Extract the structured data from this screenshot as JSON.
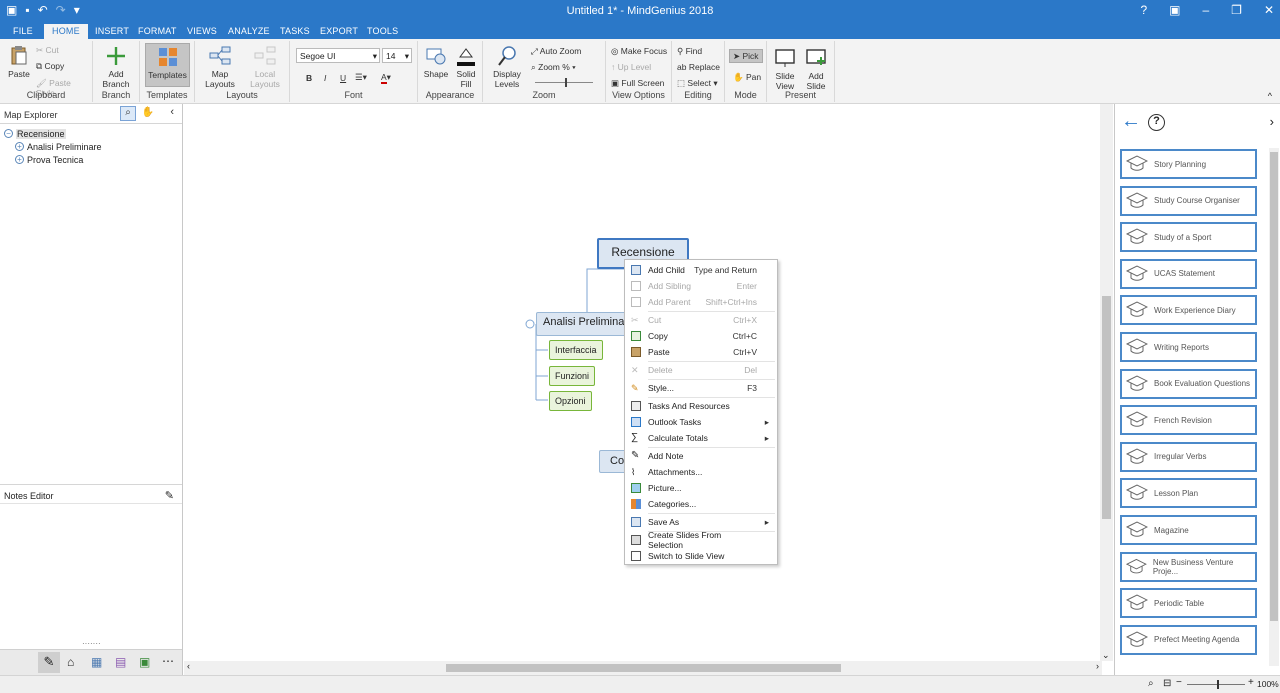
{
  "window": {
    "title": "Untitled 1* - MindGenius 2018"
  },
  "tabs": [
    "FILE",
    "HOME",
    "INSERT",
    "FORMAT",
    "VIEWS",
    "ANALYZE",
    "TASKS",
    "EXPORT",
    "TOOLS"
  ],
  "ribbon": {
    "clipboard": {
      "paste": "Paste",
      "cut": "Cut",
      "copy": "Copy",
      "paste_style": "Paste Style",
      "group": "Clipboard"
    },
    "branch": {
      "add_branch": "Add Branch",
      "group": "Branch"
    },
    "templates": {
      "templates": "Templates",
      "group": "Templates"
    },
    "layouts": {
      "map_layouts": "Map Layouts",
      "local_layouts": "Local Layouts",
      "group": "Layouts"
    },
    "font": {
      "family": "Segoe UI",
      "size": "14",
      "bold": "B",
      "italic": "I",
      "underline": "U",
      "group": "Font"
    },
    "appearance": {
      "shape": "Shape",
      "solid_fill": "Solid Fill",
      "group": "Appearance"
    },
    "zoom": {
      "display_levels": "Display Levels",
      "auto_zoom": "Auto Zoom",
      "zoom_pct": "Zoom %",
      "group": "Zoom"
    },
    "view_options": {
      "make_focus": "Make Focus",
      "up_level": "Up Level",
      "full_screen": "Full Screen",
      "group": "View Options"
    },
    "editing": {
      "find": "Find",
      "replace": "Replace",
      "select": "Select",
      "group": "Editing"
    },
    "mode": {
      "pick": "Pick",
      "pan": "Pan",
      "group": "Mode"
    },
    "present": {
      "slide_view": "Slide View",
      "add_slide": "Add Slide",
      "group": "Present"
    }
  },
  "map_explorer": {
    "title": "Map Explorer",
    "tree": [
      {
        "label": "Recensione",
        "level": 0,
        "expander": "−"
      },
      {
        "label": "Analisi Preliminare",
        "level": 1,
        "expander": "+"
      },
      {
        "label": "Prova Tecnica",
        "level": 1,
        "expander": "+"
      }
    ]
  },
  "notes_editor": {
    "title": "Notes Editor"
  },
  "map": {
    "root": "Recensione",
    "branch": "Analisi Preliminare",
    "leaves": [
      "Interfaccia",
      "Funzioni",
      "Opzioni"
    ],
    "partial_node": "Cor"
  },
  "context_menu": [
    {
      "label": "Add Child",
      "shortcut": "Type and Return",
      "disabled": false,
      "icon": "add-child-icon"
    },
    {
      "label": "Add Sibling",
      "shortcut": "Enter",
      "disabled": true,
      "icon": "add-sibling-icon"
    },
    {
      "label": "Add Parent",
      "shortcut": "Shift+Ctrl+Ins",
      "disabled": true,
      "icon": "add-parent-icon"
    },
    {
      "label": "Cut",
      "shortcut": "Ctrl+X",
      "disabled": true,
      "icon": "cut-icon"
    },
    {
      "label": "Copy",
      "shortcut": "Ctrl+C",
      "disabled": false,
      "icon": "copy-icon"
    },
    {
      "label": "Paste",
      "shortcut": "Ctrl+V",
      "disabled": false,
      "icon": "paste-icon"
    },
    {
      "label": "Delete",
      "shortcut": "Del",
      "disabled": true,
      "icon": "delete-icon"
    },
    {
      "label": "Style...",
      "shortcut": "F3",
      "disabled": false,
      "icon": "style-icon"
    },
    {
      "label": "Tasks And Resources",
      "shortcut": "",
      "disabled": false,
      "icon": "tasks-icon"
    },
    {
      "label": "Outlook Tasks",
      "shortcut": "▸",
      "disabled": false,
      "icon": "outlook-icon"
    },
    {
      "label": "Calculate Totals",
      "shortcut": "▸",
      "disabled": false,
      "icon": "sigma-icon"
    },
    {
      "label": "Add Note",
      "shortcut": "",
      "disabled": false,
      "icon": "note-icon"
    },
    {
      "label": "Attachments...",
      "shortcut": "",
      "disabled": false,
      "icon": "paperclip-icon"
    },
    {
      "label": "Picture...",
      "shortcut": "",
      "disabled": false,
      "icon": "picture-icon"
    },
    {
      "label": "Categories...",
      "shortcut": "",
      "disabled": false,
      "icon": "categories-icon"
    },
    {
      "label": "Save As",
      "shortcut": "▸",
      "disabled": false,
      "icon": "save-as-icon"
    },
    {
      "label": "Create Slides From Selection",
      "shortcut": "",
      "disabled": false,
      "icon": "slides-icon"
    },
    {
      "label": "Switch to Slide View",
      "shortcut": "",
      "disabled": false,
      "icon": "slide-view-icon"
    }
  ],
  "templates_panel": [
    "Story Planning",
    "Study Course Organiser",
    "Study of a Sport",
    "UCAS Statement",
    "Work Experience Diary",
    "Writing Reports",
    "Book Evaluation Questions",
    "French Revision",
    "Irregular Verbs",
    "Lesson Plan",
    "Magazine",
    "New Business Venture Proje...",
    "Periodic Table",
    "Prefect Meeting Agenda"
  ],
  "status": {
    "zoom": "100%"
  },
  "colors": {
    "accent": "#2b78c8",
    "node_fill": "#dce6f2",
    "leaf_border": "#78b63a"
  }
}
